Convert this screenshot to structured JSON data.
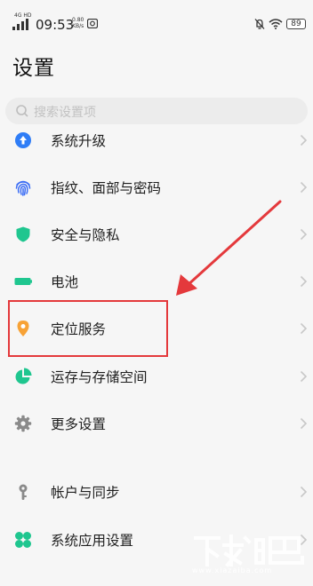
{
  "status_bar": {
    "network": "4G HD",
    "time": "09:53",
    "speed_value": "0.80",
    "speed_unit": "KB/s",
    "battery": "89"
  },
  "page": {
    "title": "设置"
  },
  "search": {
    "placeholder": "搜索设置项"
  },
  "items": [
    {
      "label": "系统升级",
      "icon": "arrow-up-circle-icon",
      "color": "#2f7df6"
    },
    {
      "label": "指纹、面部与密码",
      "icon": "fingerprint-icon",
      "color": "#3b6df5"
    },
    {
      "label": "安全与隐私",
      "icon": "shield-icon",
      "color": "#1fc68f"
    },
    {
      "label": "电池",
      "icon": "battery-icon",
      "color": "#1fc68f"
    },
    {
      "label": "定位服务",
      "icon": "location-pin-icon",
      "color": "#f7a236"
    },
    {
      "label": "运存与存储空间",
      "icon": "pie-chart-icon",
      "color": "#1fc68f"
    },
    {
      "label": "更多设置",
      "icon": "gear-icon",
      "color": "#8a8a8a"
    },
    {
      "label": "帐户与同步",
      "icon": "key-icon",
      "color": "#8a8a8a"
    },
    {
      "label": "系统应用设置",
      "icon": "four-petals-icon",
      "color": "#1fc68f"
    }
  ],
  "annotation": {
    "color": "#e4393c"
  },
  "watermark": {
    "text": "www.xiazaiba.com"
  }
}
